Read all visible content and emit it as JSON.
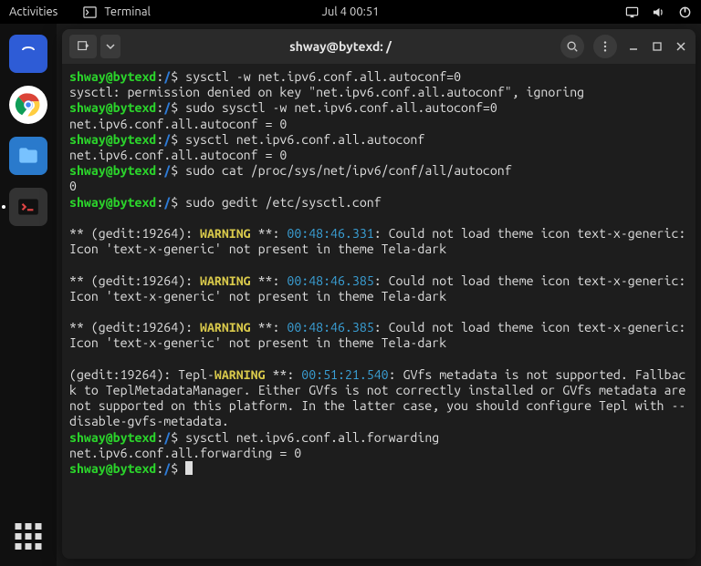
{
  "topbar": {
    "activities": "Activities",
    "app_label": "Terminal",
    "clock": "Jul 4  00:51"
  },
  "titlebar": {
    "title": "shway@bytexd: /"
  },
  "prompt": {
    "user_host": "shway@bytexd",
    "sep": ":",
    "cwd": "/",
    "sym": "$"
  },
  "lines": [
    {
      "t": "prompt",
      "cmd": "sysctl -w net.ipv6.conf.all.autoconf=0"
    },
    {
      "t": "out",
      "text": "sysctl: permission denied on key \"net.ipv6.conf.all.autoconf\", ignoring"
    },
    {
      "t": "prompt",
      "cmd": "sudo sysctl -w net.ipv6.conf.all.autoconf=0"
    },
    {
      "t": "out",
      "text": "net.ipv6.conf.all.autoconf = 0"
    },
    {
      "t": "prompt",
      "cmd": "sysctl net.ipv6.conf.all.autoconf"
    },
    {
      "t": "out",
      "text": "net.ipv6.conf.all.autoconf = 0"
    },
    {
      "t": "prompt",
      "cmd": "sudo cat /proc/sys/net/ipv6/conf/all/autoconf"
    },
    {
      "t": "out",
      "text": "0"
    },
    {
      "t": "prompt",
      "cmd": "sudo gedit /etc/sysctl.conf"
    },
    {
      "t": "blank"
    },
    {
      "t": "warn",
      "prefix": "** (gedit:19264): ",
      "tag": "WARNING",
      "mid": " **: ",
      "time": "00:48:46.331",
      "rest": ": Could not load theme icon text-x-generic: Icon 'text-x-generic' not present in theme Tela-dark"
    },
    {
      "t": "blank"
    },
    {
      "t": "warn",
      "prefix": "** (gedit:19264): ",
      "tag": "WARNING",
      "mid": " **: ",
      "time": "00:48:46.385",
      "rest": ": Could not load theme icon text-x-generic: Icon 'text-x-generic' not present in theme Tela-dark"
    },
    {
      "t": "blank"
    },
    {
      "t": "warn",
      "prefix": "** (gedit:19264): ",
      "tag": "WARNING",
      "mid": " **: ",
      "time": "00:48:46.385",
      "rest": ": Could not load theme icon text-x-generic: Icon 'text-x-generic' not present in theme Tela-dark"
    },
    {
      "t": "blank"
    },
    {
      "t": "warn",
      "prefix": "(gedit:19264): Tepl-",
      "tag": "WARNING",
      "mid": " **: ",
      "time": "00:51:21.540",
      "rest": ": GVfs metadata is not supported. Fallback to TeplMetadataManager. Either GVfs is not correctly installed or GVfs metadata are not supported on this platform. In the latter case, you should configure Tepl with --disable-gvfs-metadata."
    },
    {
      "t": "prompt",
      "cmd": "sysctl net.ipv6.conf.all.forwarding"
    },
    {
      "t": "out",
      "text": "net.ipv6.conf.all.forwarding = 0"
    },
    {
      "t": "prompt",
      "cmd": "",
      "cursor": true
    }
  ]
}
